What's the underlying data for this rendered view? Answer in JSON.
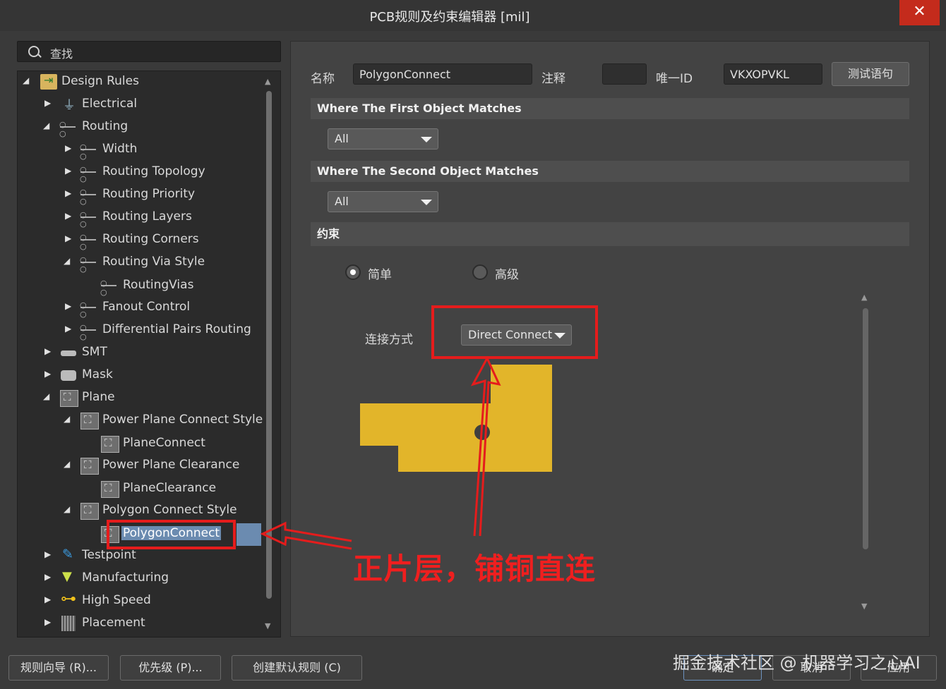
{
  "window": {
    "title": "PCB规则及约束编辑器 [mil]",
    "close_glyph": "✕"
  },
  "search": {
    "placeholder": "查找"
  },
  "tree": {
    "root": "Design Rules",
    "electrical": "Electrical",
    "routing": "Routing",
    "width": "Width",
    "topology": "Routing Topology",
    "priority": "Routing Priority",
    "layers": "Routing Layers",
    "corners": "Routing Corners",
    "via_style": "Routing Via Style",
    "routing_vias": "RoutingVias",
    "fanout": "Fanout Control",
    "diff_pairs": "Differential Pairs Routing",
    "smt": "SMT",
    "mask": "Mask",
    "plane": "Plane",
    "ppcs": "Power Plane Connect Style",
    "plane_connect": "PlaneConnect",
    "ppc": "Power Plane Clearance",
    "plane_clearance": "PlaneClearance",
    "pcs": "Polygon Connect Style",
    "polygon_connect": "PolygonConnect",
    "testpoint": "Testpoint",
    "manufacturing": "Manufacturing",
    "high_speed": "High Speed",
    "placement": "Placement"
  },
  "rule": {
    "name_label": "名称",
    "name_value": "PolygonConnect",
    "comment_label": "注释",
    "comment_value": "",
    "uid_label": "唯一ID",
    "uid_value": "VKXOPVKL",
    "test_button": "测试语句"
  },
  "first_match": {
    "header": "Where The First Object Matches",
    "value": "All"
  },
  "second_match": {
    "header": "Where The Second Object Matches",
    "value": "All"
  },
  "constraints": {
    "header": "约束",
    "mode_simple": "简单",
    "mode_advanced": "高级",
    "selected_mode": "简单",
    "connect_label": "连接方式",
    "connect_value": "Direct Connect"
  },
  "annotation": {
    "text": "正片层，铺铜直连"
  },
  "footer": {
    "wizard": "规则向导 (R)...",
    "priority": "优先级 (P)...",
    "defaults": "创建默认规则 (C)",
    "ok": "确定",
    "cancel": "取消",
    "apply": "应用"
  },
  "watermark": "掘金技术社区 @ 机器学习之心AI",
  "colors": {
    "accent_red": "#e51c1c",
    "selection": "#6b8bb0",
    "copper": "#e2b52a"
  }
}
